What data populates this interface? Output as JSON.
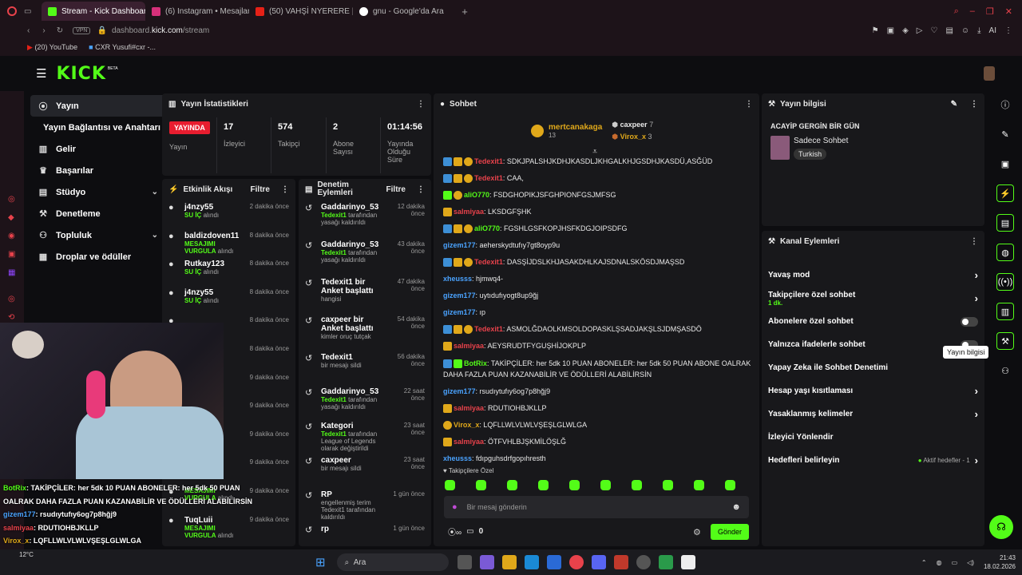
{
  "browser": {
    "tabs": [
      "Stream - Kick Dashboard",
      "(6) Instagram • Mesajlar",
      "(50) VAHŞİ NYERERE | En",
      "gnu - Google'da Ara"
    ],
    "url_host": "dashboard.",
    "url_domain": "kick.com",
    "url_path": "/stream",
    "vpn": "VPN",
    "bookmarks": [
      "(20) YouTube",
      "CXR Yusufi#cxr -..."
    ],
    "ai": "AI"
  },
  "kick": {
    "logo": "KICK",
    "beta": "BETA"
  },
  "sidebar": {
    "items": [
      "Yayın",
      "Yayın Bağlantısı ve Anahtarı",
      "Gelir",
      "Başarılar",
      "Stüdyo",
      "Denetleme",
      "Topluluk",
      "Droplar ve ödüller"
    ]
  },
  "stats": {
    "title": "Yayın İstatistikleri",
    "live": "YAYINDA",
    "live_label": "Yayın",
    "viewers": "17",
    "viewers_label": "İzleyici",
    "followers": "574",
    "followers_label": "Takipçi",
    "subs": "2",
    "subs_label": "Abone Sayısı",
    "uptime": "01:14:56",
    "uptime_label": "Yayında Olduğu Süre"
  },
  "activity": {
    "title": "Etkinlik Akışı",
    "filter": "Filtre",
    "items": [
      {
        "who": "j4nzy55",
        "what": "SU İÇ",
        "suffix": "alındı",
        "time": "2 dakika önce"
      },
      {
        "who": "baldizdoven11",
        "what": "MESAJIMI VURGULA",
        "suffix": "alındı",
        "time": "8 dakika önce"
      },
      {
        "who": "Rutkay123",
        "what": "SU İÇ",
        "suffix": "alındı",
        "time": "8 dakika önce"
      },
      {
        "who": "j4nzy55",
        "what": "SU İÇ",
        "suffix": "alındı",
        "time": "8 dakika önce"
      },
      {
        "time": "8 dakika önce"
      },
      {
        "time": "8 dakika önce"
      },
      {
        "time": "9 dakika önce"
      },
      {
        "time": "9 dakika önce"
      },
      {
        "time": "9 dakika önce"
      },
      {
        "time": "9 dakika önce"
      },
      {
        "who": "",
        "what": "MESAJIMI VURGULA",
        "suffix": "alındı",
        "time": "9 dakika önce"
      },
      {
        "who": "TuqLuii",
        "what": "MESAJIMI VURGULA",
        "suffix": "alındı",
        "time": "9 dakika önce"
      }
    ]
  },
  "moderation": {
    "title": "Denetim Eylemleri",
    "filter": "Filtre",
    "items": [
      {
        "who": "Gaddarinyo_53",
        "l1": "Tedexit1",
        "l2": "tarafından yasağı kaldırıldı",
        "time": "12 dakika önce"
      },
      {
        "who": "Gaddarinyo_53",
        "l1": "Tedexit1",
        "l2": "tarafından yasağı kaldırıldı",
        "time": "43 dakika önce"
      },
      {
        "who": "Tedexit1 bir Anket başlattı",
        "l1": "",
        "l2": "hangisi",
        "time": "47 dakika önce"
      },
      {
        "who": "caxpeer bir Anket başlattı",
        "l1": "",
        "l2": "kimler oruç tutçak",
        "time": "54 dakika önce"
      },
      {
        "who": "Tedexit1",
        "l1": "",
        "l2": "bir mesajı sildi",
        "time": "56 dakika önce"
      },
      {
        "who": "Gaddarinyo_53",
        "l1": "Tedexit1",
        "l2": "tarafından yasağı kaldırıldı",
        "time": "22 saat önce"
      },
      {
        "who": "Kategori",
        "l1": "Tedexit1",
        "l2": "tarafından League of Legends olarak değiştirildi",
        "time": "23 saat önce"
      },
      {
        "who": "caxpeer",
        "l1": "",
        "l2": "bir mesajı sildi",
        "time": "23 saat önce"
      },
      {
        "who": "RP",
        "l1": "",
        "l2": "engellenmiş terim Tedexit1 tarafından kaldırıldı",
        "time": "1 gün önce"
      },
      {
        "who": "rp",
        "l1": "",
        "l2": "",
        "time": "1 gün önce"
      }
    ]
  },
  "chat": {
    "title": "Sohbet",
    "top": [
      {
        "name": "mertcanakaga",
        "count": "13"
      },
      {
        "name": "caxpeer",
        "count": "7"
      },
      {
        "name": "Virox_x",
        "count": "3"
      }
    ],
    "lines": [
      {
        "u": "Tedexit1",
        "c": "#e8424b",
        "b": "123",
        "t": ": SDKJPALSHJKDHJKASDLJKHGALKHJGSDHJKASDÜ,ASĞÜD"
      },
      {
        "u": "Tedexit1",
        "c": "#e8424b",
        "b": "123",
        "t": ": CAA,"
      },
      {
        "u": "aliO770",
        "c": "#53fc18",
        "b": "43",
        "t": ": FSDGHOPIKJSFGHPIONFGSJMFSG"
      },
      {
        "u": "salmiyaa",
        "c": "#e8424b",
        "b": "2",
        "t": ": LKSDGFŞHK"
      },
      {
        "u": "aliO770",
        "c": "#53fc18",
        "b": "123",
        "t": ": FGSHLGSFKOPJHSFKDGJOIPSDFG"
      },
      {
        "u": "gizem177",
        "c": "#4aa3ff",
        "b": "",
        "t": ": aeherskydtufıy7gt8oyp9u"
      },
      {
        "u": "Tedexit1",
        "c": "#e8424b",
        "b": "123",
        "t": ": DASŞİJDSLKHJASAKDHLKAJSDNALSKÖSDJMAŞSD"
      },
      {
        "u": "xheusss",
        "c": "#4aa3ff",
        "b": "",
        "t": ": hjmwq4-"
      },
      {
        "u": "gizem177",
        "c": "#4aa3ff",
        "b": "",
        "t": ": uytıdufıyogt8up9ğj"
      },
      {
        "u": "gizem177",
        "c": "#4aa3ff",
        "b": "",
        "t": ": ıp"
      },
      {
        "u": "Tedexit1",
        "c": "#e8424b",
        "b": "123",
        "t": ": ASMOLĞDAOLKMSOLDOPASKLŞSADJAKŞLSJDMŞASDÖ"
      },
      {
        "u": "salmiyaa",
        "c": "#e8424b",
        "b": "2",
        "t": ": AEYSRUDTFYGUŞHİJOKPLP"
      },
      {
        "u": "BotRix",
        "c": "#53fc18",
        "b": "14",
        "t": ": TAKİPÇİLER: her 5dk 10 PUAN ABONELER: her 5dk 50 PUAN ABONE OALRAK"
      },
      {
        "u": "",
        "c": "#fff",
        "b": "",
        "t": "DAHA FAZLA PUAN KAZANABİLİR VE ÖDÜLLERİ ALABİLİRSİN"
      },
      {
        "u": "gizem177",
        "c": "#4aa3ff",
        "b": "",
        "t": ": rsudıytufıy6og7p8hğj9"
      },
      {
        "u": "salmiyaa",
        "c": "#e8424b",
        "b": "2",
        "t": ": RDUTIOHBJKLLP"
      },
      {
        "u": "Virox_x",
        "c": "#e0a81a",
        "b": "3",
        "t": ": LQFLLWLVLWLVŞEŞLGLWLGA"
      },
      {
        "u": "salmiyaa",
        "c": "#e8424b",
        "b": "2",
        "t": ": ÖTFVHLBJŞKMİLÖŞLĞ"
      },
      {
        "u": "xheusss",
        "c": "#4aa3ff",
        "b": "",
        "t": ": fdıpguhsdrfgopıhresth"
      }
    ],
    "followers_only": "Takipçilere Özel",
    "placeholder": "Bir mesaj gönderin",
    "points": "0",
    "send": "Gönder"
  },
  "streaminfo": {
    "title": "Yayın bilgisi",
    "stream_title": "ACAYİP GERGİN BİR GÜN",
    "category": "Sadece Sohbet",
    "lang": "Turkish"
  },
  "channel": {
    "title": "Kanal Eylemleri",
    "items": [
      {
        "label": "Yavaş mod",
        "type": "chev"
      },
      {
        "label": "Takipçilere özel sohbet",
        "sub": "1 dk.",
        "type": "chev"
      },
      {
        "label": "Abonelere özel sohbet",
        "type": "tog"
      },
      {
        "label": "Yalnızca ifadelerle sohbet",
        "type": "tog"
      },
      {
        "label": "Yapay Zeka ile Sohbet Denetimi",
        "type": "none"
      },
      {
        "label": "Hesap yaşı kısıtlaması",
        "type": "chev"
      },
      {
        "label": "Yasaklanmış kelimeler",
        "type": "chev"
      },
      {
        "label": "İzleyici Yönlendir",
        "type": "none"
      },
      {
        "label": "Hedefleri belirleyin",
        "type": "goal",
        "goal": "Aktif hedefler - 1"
      }
    ]
  },
  "tooltip": "Yayın bilgisi",
  "overlay": {
    "lines": [
      {
        "u": "BotRix",
        "t": ": TAKİPÇİLER: her 5dk 10 PUAN ABONELER: her 5dk 50 PUAN"
      },
      {
        "u": "",
        "t": "OALRAK DAHA FAZLA PUAN KAZANABİLİR VE ÖDÜLLERİ ALABİLİRSİN"
      },
      {
        "u": "gizem177",
        "t": ": rsudıytufıy6og7p8hğj9"
      },
      {
        "u": "salmiyaa",
        "t": ": RDUTIOHBJKLLP"
      },
      {
        "u": "Virox_x",
        "t": ": LQFLLWLVLWLVŞEŞLGLWLGA"
      },
      {
        "u": "salmiyaa",
        "t": ": ÖTFVHLBJŞKMİLÖŞLĞ"
      },
      {
        "u": "xheusss",
        "t": ": fdıpguhsdrfgopıhresth"
      }
    ]
  },
  "taskbar": {
    "search": "Ara",
    "time": "21:43",
    "date": "18.02.2026",
    "temp": "12°C"
  }
}
